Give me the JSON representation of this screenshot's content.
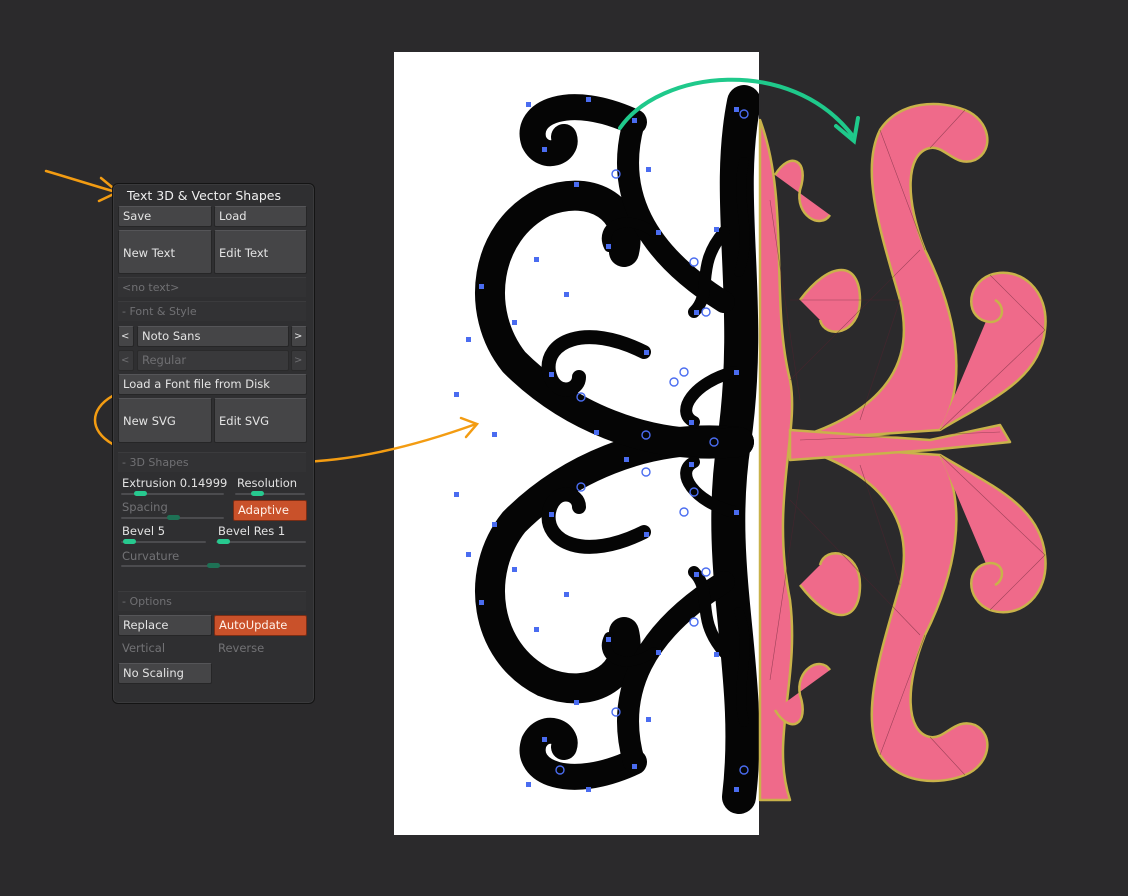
{
  "panel": {
    "title": "Text 3D & Vector Shapes",
    "save": "Save",
    "load": "Load",
    "new_text": "New Text",
    "edit_text": "Edit Text",
    "no_text": "<no text>",
    "font_style_header": "- Font & Style",
    "prev_arrow": "< I",
    "next_arrow": "> I",
    "font_name": "Noto Sans",
    "font_weight": "Regular",
    "load_font": "Load a Font file from Disk",
    "new_svg": "New SVG",
    "edit_svg": "Edit SVG",
    "shapes_header": "- 3D Shapes",
    "extrusion_label": "Extrusion",
    "extrusion_value": "0.14999",
    "resolution_label": "Resolution",
    "spacing_label": "Spacing",
    "adaptive": "Adaptive",
    "bevel_label": "Bevel",
    "bevel_value": "5",
    "bevel_res_label": "Bevel Res",
    "bevel_res_value": "1",
    "curvature_label": "Curvature",
    "options_header": "- Options",
    "replace": "Replace",
    "autoupdate": "AutoUpdate",
    "vertical": "Vertical",
    "reverse": "Reverse",
    "no_scaling": "No Scaling"
  },
  "sliders": {
    "extrusion": 0.15,
    "resolution": 0.35,
    "spacing": 0.5,
    "bevel": 0.05,
    "bevel_res": 0.03,
    "curvature": 0.5
  },
  "colors": {
    "background": "#2b2a2c",
    "accent_orange": "#c9512a",
    "slider_green": "#27c98f",
    "annotation_orange": "#f39c12",
    "annotation_green": "#1fc98b",
    "mesh_pink": "#ef6a8a",
    "vector_blue": "#4a6cf0"
  }
}
